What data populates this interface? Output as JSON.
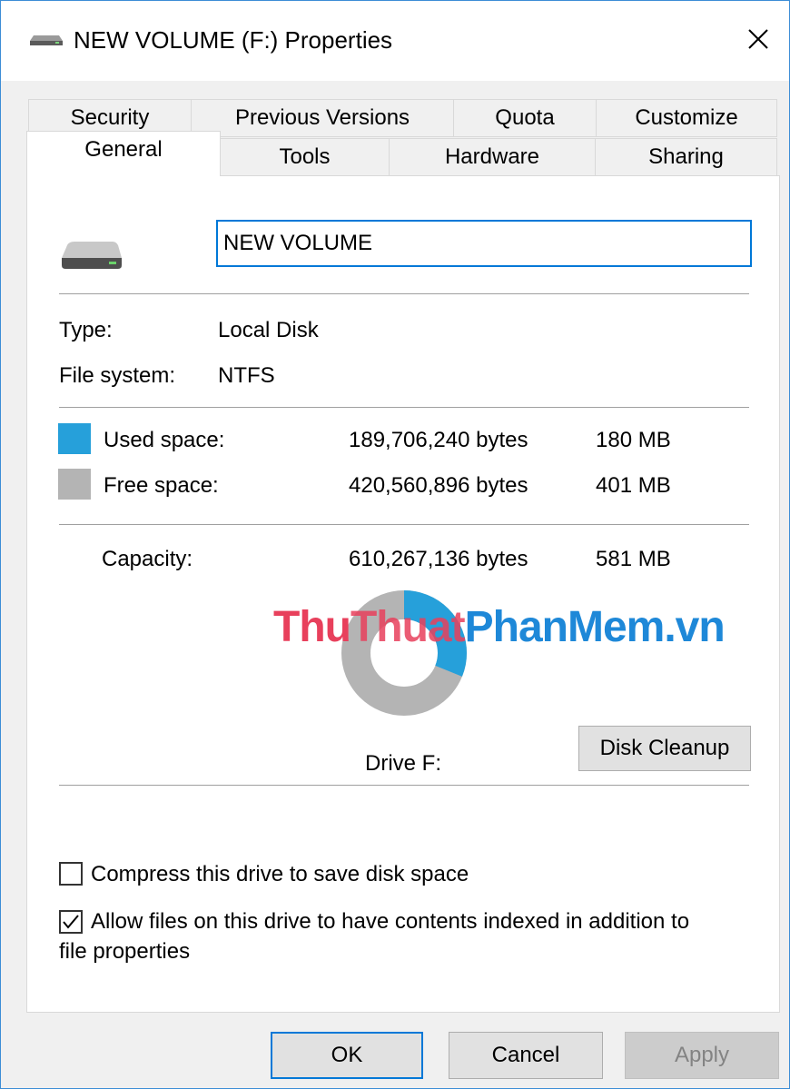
{
  "window": {
    "title": "NEW VOLUME (F:) Properties",
    "title_icon": "drive-icon",
    "close_icon": "close-icon"
  },
  "tabs": {
    "row1": [
      "Security",
      "Previous Versions",
      "Quota",
      "Customize"
    ],
    "row2": [
      "General",
      "Tools",
      "Hardware",
      "Sharing"
    ],
    "active": "General"
  },
  "general": {
    "drive_icon": "hard-drive-icon",
    "volume_name": "NEW VOLUME",
    "type_label": "Type:",
    "type_value": "Local Disk",
    "fs_label": "File system:",
    "fs_value": "NTFS",
    "used": {
      "label": "Used space:",
      "bytes": "189,706,240 bytes",
      "size": "180 MB",
      "color": "#26a0da"
    },
    "free": {
      "label": "Free space:",
      "bytes": "420,560,896 bytes",
      "size": "401 MB",
      "color": "#b4b4b4"
    },
    "capacity": {
      "label": "Capacity:",
      "bytes": "610,267,136 bytes",
      "size": "581 MB"
    },
    "used_fraction": 0.311,
    "drive_label": "Drive F:",
    "disk_cleanup": "Disk Cleanup",
    "compress_label": "Compress this drive to save disk space",
    "compress_checked": false,
    "index_label_line1": "Allow files on this drive to have contents indexed in addition to",
    "index_label_line2": "file properties",
    "index_checked": true
  },
  "buttons": {
    "ok": "OK",
    "cancel": "Cancel",
    "apply": "Apply"
  },
  "watermark": {
    "part1": "Thu",
    "part2": "Thuat",
    "part3": "PhanMem",
    "part4": ".vn"
  }
}
